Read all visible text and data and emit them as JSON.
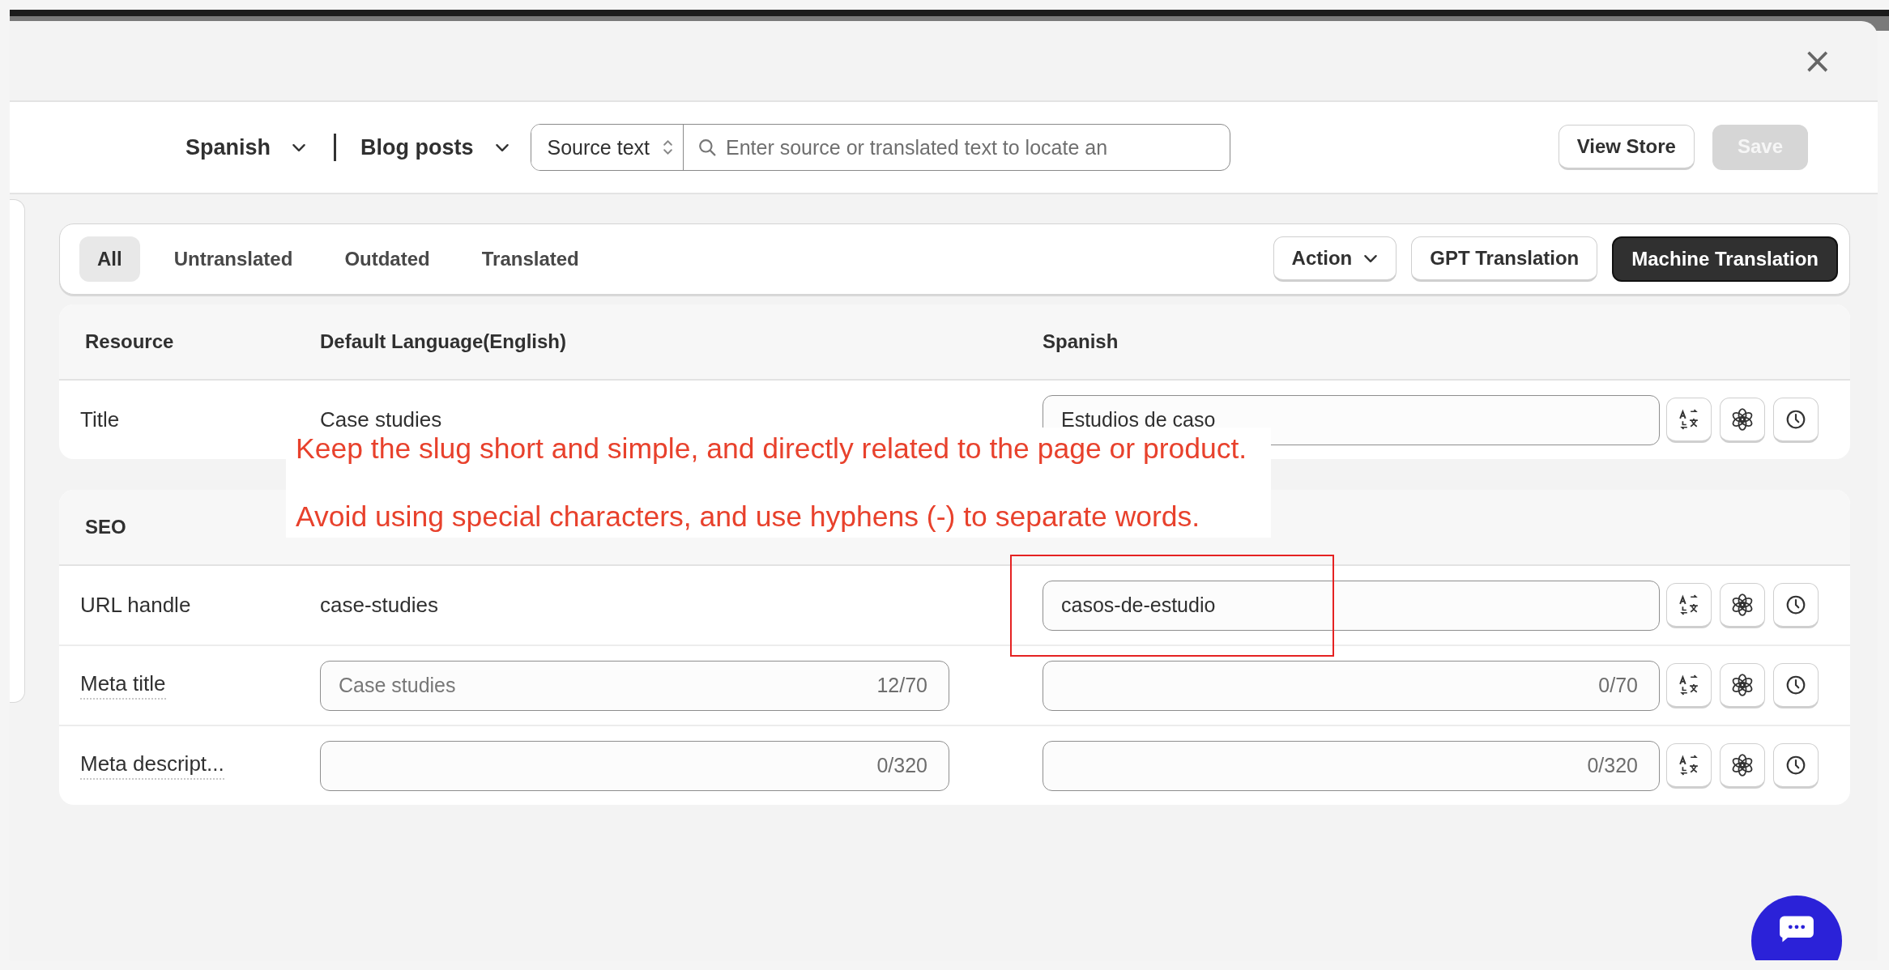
{
  "dialog": {
    "close_label": "×"
  },
  "toolbar": {
    "language": "Spanish",
    "resource_type": "Blog posts",
    "search_mode": "Source text",
    "search": {
      "placeholder": "Enter source or translated text to locate an"
    },
    "buttons": [
      {
        "label": "View Store",
        "disabled": false
      },
      {
        "label": "Save",
        "disabled": true
      }
    ]
  },
  "filter_tabs": [
    {
      "label": "All",
      "selected": true
    },
    {
      "label": "Untranslated",
      "selected": false
    },
    {
      "label": "Outdated",
      "selected": false
    },
    {
      "label": "Translated",
      "selected": false
    }
  ],
  "actions": [
    {
      "label": "Action",
      "kind": "dropdown"
    },
    {
      "label": "GPT Translation",
      "kind": "outline"
    },
    {
      "label": "Machine Translation",
      "kind": "primary"
    }
  ],
  "table": {
    "columns": [
      "Resource",
      "Default Language(English)",
      "Spanish"
    ],
    "rows": [
      {
        "label": "Title",
        "hint": false,
        "source": {
          "kind": "text",
          "value": "Case studies"
        },
        "target": {
          "value": "Estudios de caso"
        }
      }
    ]
  },
  "seo": {
    "title": "SEO",
    "rows": [
      {
        "label": "URL handle",
        "hint": false,
        "source": {
          "kind": "text",
          "value": "case-studies"
        },
        "target": {
          "value": "casos-de-estudio"
        },
        "highlighted": true
      },
      {
        "label": "Meta title",
        "hint": true,
        "source": {
          "kind": "field",
          "value": "Case studies",
          "counter": "12/70"
        },
        "target": {
          "counter": "0/70"
        },
        "highlighted": false
      },
      {
        "label": "Meta descript...",
        "hint": true,
        "source": {
          "kind": "field",
          "counter": "0/320"
        },
        "target": {
          "counter": "0/320"
        },
        "highlighted": false
      }
    ]
  },
  "annotation": {
    "lines": [
      "Keep the slug short and simple, and directly related to the page or product.",
      "Avoid using special characters, and use hyphens (-) to separate words."
    ]
  }
}
